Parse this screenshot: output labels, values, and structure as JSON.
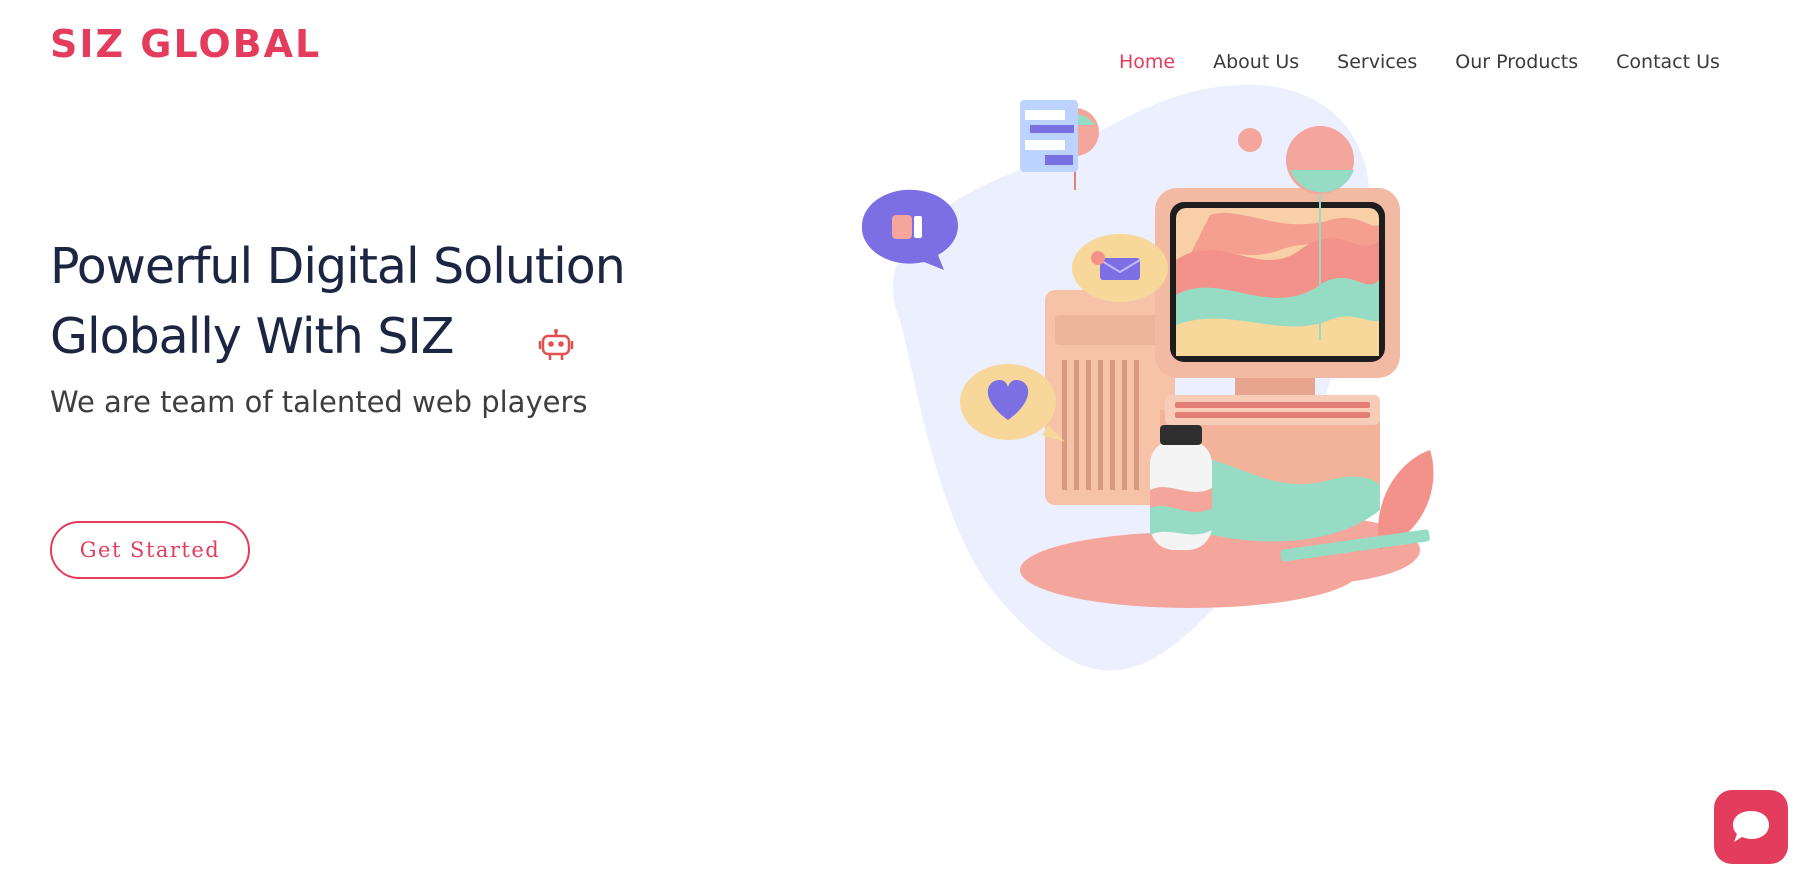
{
  "brand": {
    "logo_text": "SIZ GLOBAL",
    "color": "#e43c5c"
  },
  "nav": {
    "items": [
      {
        "label": "Home",
        "active": true
      },
      {
        "label": "About Us",
        "active": false
      },
      {
        "label": "Services",
        "active": false
      },
      {
        "label": "Our Products",
        "active": false
      },
      {
        "label": "Contact Us",
        "active": false
      }
    ]
  },
  "hero": {
    "title": "Powerful Digital Solution Globally With SIZ",
    "subtitle": "We are team of talented web players",
    "cta_label": "Get Started",
    "title_color": "#1c2541",
    "illustration": "computer-workspace-illustration",
    "decor_icon": "robot-icon"
  },
  "chat_widget": {
    "icon": "chat-bubble-icon",
    "color": "#e43c5c"
  }
}
